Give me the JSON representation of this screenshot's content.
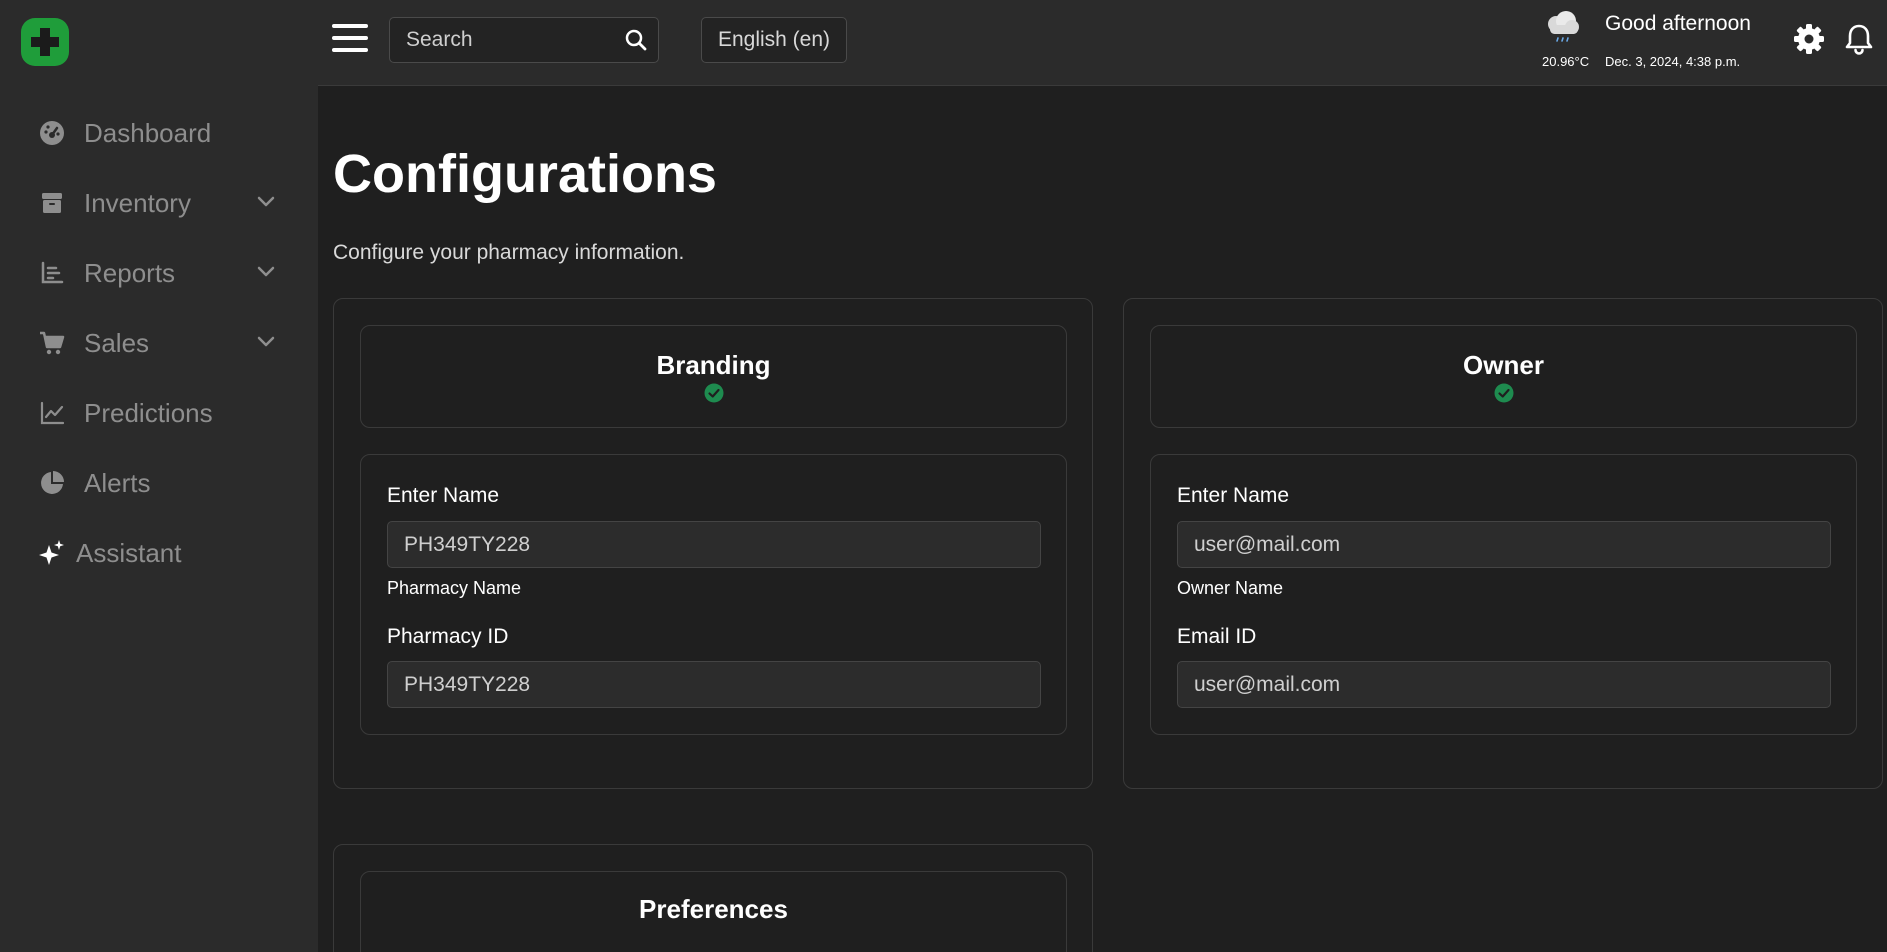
{
  "header": {
    "search_placeholder": "Search",
    "language": "English (en)",
    "temperature": "20.96°C",
    "greeting": "Good afternoon",
    "datetime": "Dec. 3, 2024, 4:38 p.m."
  },
  "sidebar": {
    "items": [
      {
        "label": "Dashboard",
        "icon": "dashboard-icon"
      },
      {
        "label": "Inventory",
        "icon": "box-icon",
        "expandable": true
      },
      {
        "label": "Reports",
        "icon": "reports-icon",
        "expandable": true
      },
      {
        "label": "Sales",
        "icon": "cart-icon",
        "expandable": true
      },
      {
        "label": "Predictions",
        "icon": "line-chart-icon"
      },
      {
        "label": "Alerts",
        "icon": "pie-icon"
      },
      {
        "label": "Assistant",
        "icon": "sparkles-icon"
      }
    ]
  },
  "main": {
    "title": "Configurations",
    "subtitle": "Configure your pharmacy information.",
    "branding": {
      "title": "Branding",
      "name_label": "Enter Name",
      "name_value": "PH349TY228",
      "name_help": "Pharmacy Name",
      "id_label": "Pharmacy ID",
      "id_value": "PH349TY228"
    },
    "owner": {
      "title": "Owner",
      "name_label": "Enter Name",
      "name_value": "user@mail.com",
      "name_help": "Owner Name",
      "email_label": "Email ID",
      "email_value": "user@mail.com"
    },
    "preferences": {
      "title": "Preferences"
    }
  },
  "colors": {
    "brand": "#1f9d3a",
    "check": "#1e8b4f",
    "sidebar_bg": "#2b2b2b",
    "page_bg": "#1f1f1f"
  }
}
